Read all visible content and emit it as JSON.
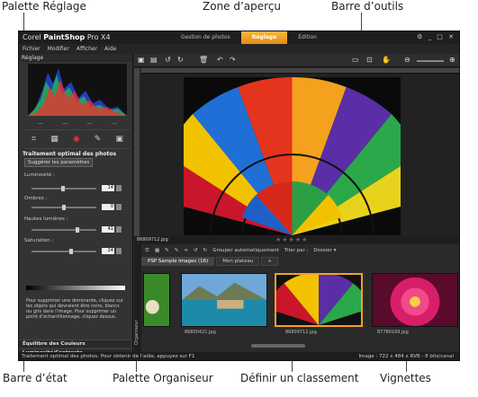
{
  "callouts": {
    "palette_reglage": "Palette Réglage",
    "zone_apercu": "Zone d’aperçu",
    "barre_outils": "Barre d’outils",
    "barre_etat": "Barre d’état",
    "palette_organiseur": "Palette Organiseur",
    "definir_classement": "Définir un classement",
    "vignettes": "Vignettes"
  },
  "app": {
    "brand_prefix": "Corel ",
    "brand_name": "PaintShop",
    "brand_suffix": " Pro X4",
    "mode_tabs": [
      {
        "label": "Gestion de photos",
        "active": false
      },
      {
        "label": "Réglage",
        "active": true
      },
      {
        "label": "Édition",
        "active": false
      }
    ],
    "window_controls": "⚙ _ □ ✕",
    "accent_color": "#f2a22b"
  },
  "menu": {
    "items": [
      "Fichier",
      "Modifier",
      "Afficher",
      "Aide"
    ]
  },
  "left_panel": {
    "title": "Réglage",
    "dashes": [
      "—",
      "—",
      "—",
      "—"
    ],
    "section_title": "Traitement optimal des photos",
    "suggest_button": "Suggérer les paramètres",
    "sliders": [
      {
        "label": "Luminosité :",
        "value": "14",
        "fraction": 0.48
      },
      {
        "label": "Ombres :",
        "value": "0",
        "fraction": 0.5
      },
      {
        "label": "Hautes lumières :",
        "value": "41",
        "fraction": 0.72
      },
      {
        "label": "Saturation :",
        "value": "24",
        "fraction": 0.62
      }
    ],
    "help_text": "Pour supprimer une dominante, cliquez sur les objets qui devraient être noirs, blancs ou gris dans l’image. Pour supprimer un point d’échantillonnage, cliquez dessus.",
    "accordions": [
      "Équilibre des Couleurs",
      "Luminosité/Contraste"
    ]
  },
  "preview": {
    "filename": "86809712.jpg",
    "rating_stars": "★★★★★"
  },
  "organizer": {
    "side_label": "Organiseur",
    "tool_group_label": "Grouper automatiquement",
    "sort_label": "Trier par :",
    "folder_label": "Dossier ▾",
    "tabs": [
      {
        "label": "PSP Sample images (16)",
        "active": true
      },
      {
        "label": "Mon plateau",
        "active": false
      },
      {
        "label": "+",
        "active": false
      }
    ],
    "thumbnails": [
      {
        "name": "",
        "selected": false
      },
      {
        "name": "86800421.jpg",
        "selected": false
      },
      {
        "name": "86809712.jpg",
        "selected": true
      },
      {
        "name": "87780169.jpg",
        "selected": false
      }
    ]
  },
  "status": {
    "left": "Traitement optimal des photos: Pour obtenir de l’aide, appuyez sur F1",
    "right": "Image : 722 x 484 x RVB - 8 bits/canal"
  }
}
